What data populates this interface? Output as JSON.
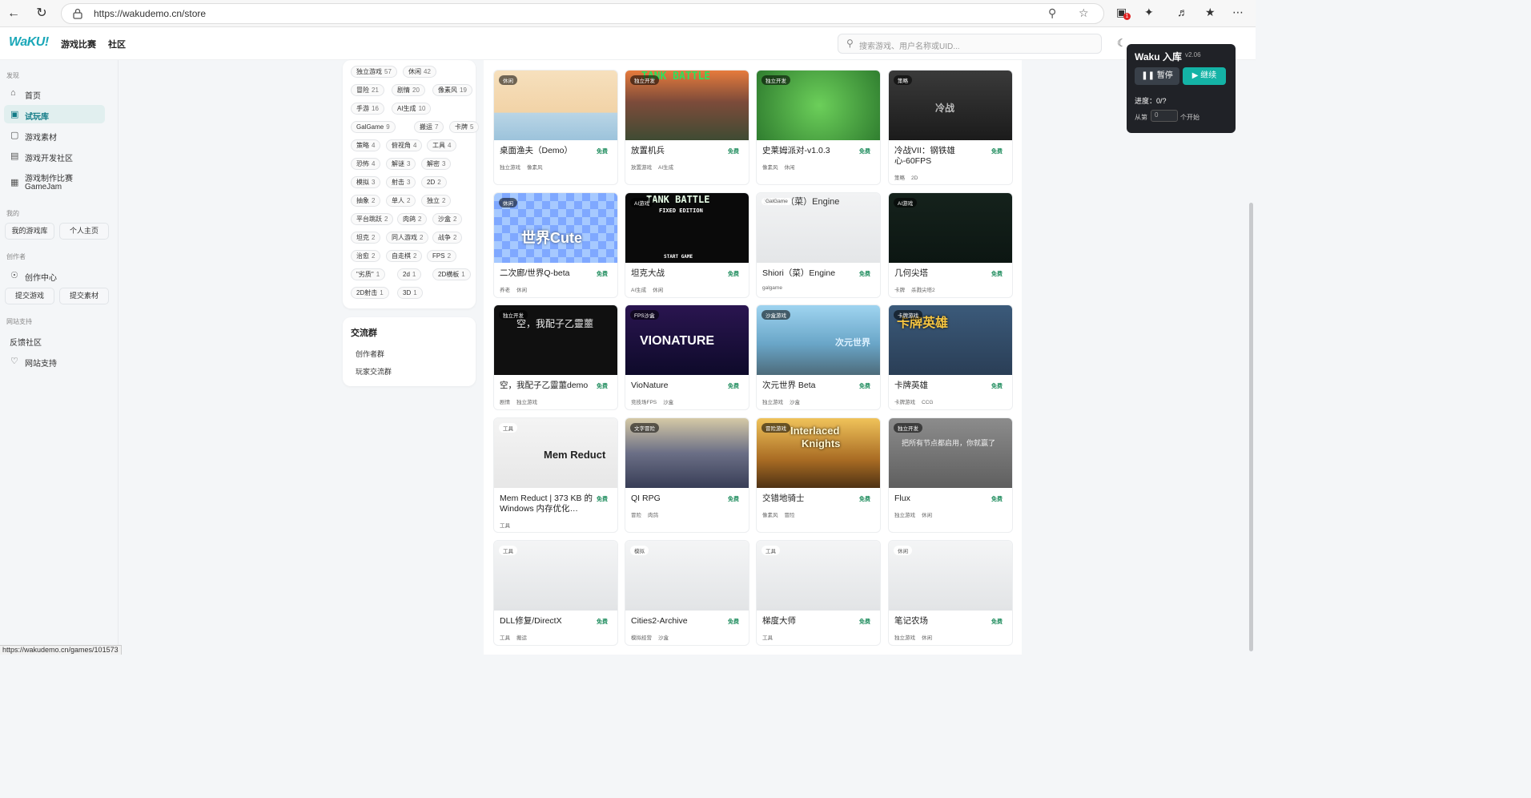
{
  "browser": {
    "url": "https://wakudemo.cn/store",
    "extension_badge": "1",
    "status_url": "https://wakudemo.cn/games/101573"
  },
  "header": {
    "logo": "WaKU!",
    "nav": [
      "游戏比赛",
      "社区"
    ],
    "search_placeholder": "搜索游戏、用户名称或UID..."
  },
  "sidebar": {
    "sections": {
      "discover": "发现",
      "mine": "我的",
      "creator": "创作者",
      "support": "网站支持"
    },
    "items": {
      "home": "首页",
      "library": "试玩库",
      "assets": "游戏素材",
      "devcommunity": "游戏开发社区",
      "gamejam_1": "游戏制作比赛",
      "gamejam_2": "GameJam",
      "mylib": "我的游戏库",
      "profile": "个人主页",
      "creatorcenter": "创作中心",
      "submitgame": "提交游戏",
      "submitasset": "提交素材",
      "feedback": "反馈社区",
      "sitesupport": "网站支持"
    }
  },
  "filters": {
    "tags": [
      {
        "name": "独立游戏",
        "count": "57"
      },
      {
        "name": "休闲",
        "count": "42"
      },
      {
        "name": "冒险",
        "count": "21"
      },
      {
        "name": "剧情",
        "count": "20"
      },
      {
        "name": "像素风",
        "count": "19"
      },
      {
        "name": "手游",
        "count": "16"
      },
      {
        "name": "AI生成",
        "count": "10"
      },
      {
        "name": "GalGame",
        "count": "9"
      },
      {
        "name": "搬运",
        "count": "7"
      },
      {
        "name": "卡牌",
        "count": "5"
      },
      {
        "name": "策略",
        "count": "4"
      },
      {
        "name": "俯视角",
        "count": "4"
      },
      {
        "name": "工具",
        "count": "4"
      },
      {
        "name": "恐怖",
        "count": "4"
      },
      {
        "name": "解谜",
        "count": "3"
      },
      {
        "name": "解密",
        "count": "3"
      },
      {
        "name": "模拟",
        "count": "3"
      },
      {
        "name": "射击",
        "count": "3"
      },
      {
        "name": "2D",
        "count": "2"
      },
      {
        "name": "抽象",
        "count": "2"
      },
      {
        "name": "单人",
        "count": "2"
      },
      {
        "name": "独立",
        "count": "2"
      },
      {
        "name": "平台跳跃",
        "count": "2"
      },
      {
        "name": "肉鸽",
        "count": "2"
      },
      {
        "name": "沙盒",
        "count": "2"
      },
      {
        "name": "坦克",
        "count": "2"
      },
      {
        "name": "同人游戏",
        "count": "2"
      },
      {
        "name": "战争",
        "count": "2"
      },
      {
        "name": "治愈",
        "count": "2"
      },
      {
        "name": "自走棋",
        "count": "2"
      },
      {
        "name": "FPS",
        "count": "2"
      },
      {
        "name": "\"劣质\"",
        "count": "1"
      },
      {
        "name": "2d",
        "count": "1"
      },
      {
        "name": "2D横板",
        "count": "1"
      },
      {
        "name": "2D射击",
        "count": "1"
      },
      {
        "name": "3D",
        "count": "1"
      }
    ],
    "group_title": "交流群",
    "group_links": [
      "创作者群",
      "玩家交流群"
    ]
  },
  "games": [
    {
      "badge": "休闲",
      "title": "桌面渔夫（Demo）",
      "price": "免费",
      "tags": [
        "独立游戏",
        "像素风"
      ]
    },
    {
      "badge": "独立开发",
      "title": "放置机兵",
      "price": "免费",
      "tags": [
        "放置游戏",
        "AI生成"
      ]
    },
    {
      "badge": "独立开发",
      "title": "史莱姆派对-v1.0.3",
      "price": "免费",
      "tags": [
        "像素风",
        "休闲"
      ]
    },
    {
      "badge": "策略",
      "title": "冷战VII：钢铁雄心-60FPS",
      "price": "免费",
      "tags": [
        "策略",
        "2D"
      ]
    },
    {
      "badge": "休闲",
      "title": "二次廊/世界Q-beta",
      "price": "免费",
      "tags": [
        "养老",
        "休闲"
      ]
    },
    {
      "badge": "AI游戏",
      "title": "坦克大战",
      "price": "免费",
      "tags": [
        "AI生成",
        "休闲"
      ]
    },
    {
      "badge": "GalGame",
      "title": "Shiori（菜）Engine",
      "price": "免费",
      "tags": [
        "galgame"
      ]
    },
    {
      "badge": "AI游戏",
      "title": "几何尖塔",
      "price": "免费",
      "tags": [
        "卡牌",
        "杀戮尖塔2"
      ]
    },
    {
      "badge": "独立开发",
      "title": "空，我配子乙靈蘁demo",
      "price": "免费",
      "tags": [
        "剧情",
        "独立游戏"
      ]
    },
    {
      "badge": "FPS沙盒",
      "title": "VioNature",
      "price": "免费",
      "tags": [
        "竞技场FPS",
        "沙盒"
      ]
    },
    {
      "badge": "沙盒游戏",
      "title": "次元世界 Beta",
      "price": "免费",
      "tags": [
        "独立游戏",
        "沙盒"
      ]
    },
    {
      "badge": "卡牌游戏",
      "title": "卡牌英雄",
      "price": "免费",
      "tags": [
        "卡牌游戏",
        "CCG"
      ]
    },
    {
      "badge": "工具",
      "title": "Mem Reduct | 373 KB 的 Windows 内存优化…",
      "price": "免费",
      "tags": [
        "工具"
      ]
    },
    {
      "badge": "文字冒险",
      "title": "QI RPG",
      "price": "免费",
      "tags": [
        "冒险",
        "肉鸽"
      ]
    },
    {
      "badge": "冒险游戏",
      "title": "交错地骑士",
      "price": "免费",
      "tags": [
        "像素风",
        "冒险"
      ]
    },
    {
      "badge": "独立开发",
      "title": "Flux",
      "price": "免费",
      "tags": [
        "独立游戏",
        "休闲"
      ]
    },
    {
      "badge": "工具",
      "title": "DLL修复/DirectX",
      "price": "免费",
      "tags": [
        "工具",
        "搬运"
      ]
    },
    {
      "badge": "模拟",
      "title": "Cities2-Archive",
      "price": "免费",
      "tags": [
        "模拟经营",
        "沙盒"
      ]
    },
    {
      "badge": "工具",
      "title": "梯度大师",
      "price": "免费",
      "tags": [
        "工具"
      ]
    },
    {
      "badge": "休闲",
      "title": "笔记农场",
      "price": "免费",
      "tags": [
        "独立游戏",
        "休闲"
      ]
    }
  ],
  "thumb_text": {
    "tank_1": "TANK BATTLE",
    "tank_2": "FIXED EDITION",
    "tank_3": "START GAME",
    "shiori": "Shiori（菜）Engine",
    "miku_1": "世界Cute",
    "sora": "空，我配子乙靈蘁",
    "vionature": "VIONATURE",
    "jiyuan": "次元世界",
    "card": "卡牌英雄",
    "mem": "Mem Reduct",
    "knights_1": "Interlaced",
    "knights_2": "Knights",
    "flux": "把所有节点都启用，你就赢了",
    "cold": "冷战"
  },
  "waku_panel": {
    "title": "Waku 入库",
    "version": "v2.06",
    "pause": "暂停",
    "resume": "继续",
    "progress": "进度：0/?",
    "from": "从第",
    "from_value": "0",
    "start": "个开始"
  },
  "colors": {
    "accent": "#14b3a6",
    "brand": "#1aa7b8",
    "free": "#1a8a5a"
  }
}
